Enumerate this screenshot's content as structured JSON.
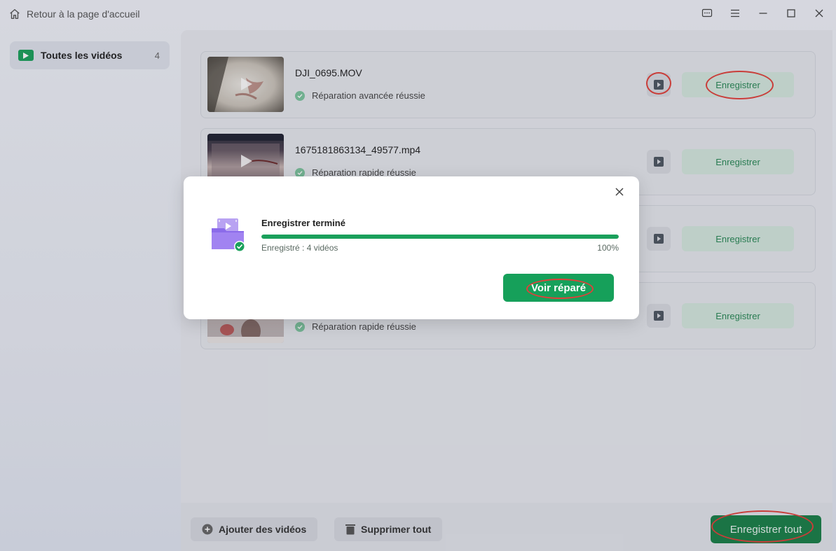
{
  "titlebar": {
    "home_label": "Retour à la page d'accueil",
    "icons": [
      "feedback-icon",
      "menu-icon",
      "minimize-icon",
      "maximize-icon",
      "close-icon"
    ]
  },
  "sidebar": {
    "items": [
      {
        "label": "Toutes les vidéos",
        "count": "4",
        "icon": "video-play-icon"
      }
    ]
  },
  "videos": [
    {
      "name": "DJI_0695.MOV",
      "status": "Réparation avancée réussie",
      "save_label": "Enregistrer"
    },
    {
      "name": "1675181863134_49577.mp4",
      "status": "Réparation rapide réussie",
      "save_label": "Enregistrer"
    },
    {
      "name": "",
      "status": "",
      "save_label": "Enregistrer"
    },
    {
      "name": "",
      "status": "Réparation rapide réussie",
      "save_label": "Enregistrer"
    }
  ],
  "bottom": {
    "add_label": "Ajouter des vidéos",
    "delete_label": "Supprimer tout",
    "save_all_label": "Enregistrer tout"
  },
  "modal": {
    "title": "Enregistrer terminé",
    "saved_text": "Enregistré : 4 vidéos",
    "percent_text": "100%",
    "progress": 1.0,
    "view_button": "Voir réparé"
  },
  "colors": {
    "accent_green": "#16a05a",
    "dark_green": "#1a7f47",
    "annotation_red": "#e0403a"
  }
}
